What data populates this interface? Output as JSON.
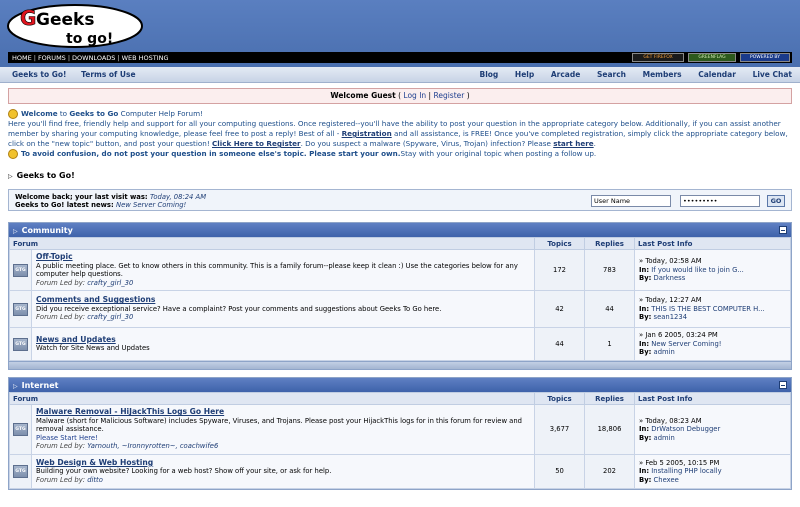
{
  "logo": {
    "text_top": "Geeks",
    "text_bottom": "to go!"
  },
  "topnav": [
    "HOME",
    "FORUMS",
    "DOWNLOADS",
    "WEB HOSTING"
  ],
  "badges": [
    "GET FIREFOX",
    "GREENFLAG",
    "POWERED BY"
  ],
  "subnav": {
    "left": [
      "Geeks to Go!",
      "Terms of Use"
    ],
    "right": [
      "Blog",
      "Help",
      "Arcade",
      "Search",
      "Members",
      "Calendar",
      "Live Chat"
    ]
  },
  "guest": {
    "welcome": "Welcome Guest",
    "open": "( ",
    "login": "Log In",
    "sep": " | ",
    "register": "Register",
    "close": " )"
  },
  "intro": {
    "welcome_pre": "Welcome",
    "welcome_mid": " to ",
    "site_name": "Geeks to Go",
    "welcome_post": " Computer Help Forum!",
    "p1": "Here you'll find free, friendly help and support for all your computing questions. Once registered--you'll have the ability to post your question in the appropriate category below. Additionally, if you can assist another member by sharing your computing knowledge, please feel free to post a reply! Best of all -",
    "registration": "Registration",
    "p2": " and all assistance, is FREE! Once you've completed registration, simply click the appropriate category below, click on the \"new topic\" button, and post your question!",
    "click_here": "Click Here to Register",
    "p3": ". Do you suspect a malware (Spyware, Virus, Trojan) infection? Please",
    "start_here": "start here",
    "p4": ".",
    "warn": "To avoid confusion, do not post your question in someone else's topic. Please start your own.",
    "warn2": " Stay with your original topic when posting a follow up."
  },
  "board_title": "Geeks to Go!",
  "login": {
    "last_visit_label": "Welcome back; your last visit was: ",
    "last_visit_value": "Today, 08:24 AM",
    "news_label": "Geeks to Go! latest news: ",
    "news_value": "New Server Coming!",
    "username_placeholder": "User Name",
    "password_value": "•••••••••",
    "go": "GO"
  },
  "columns": {
    "forum": "Forum",
    "topics": "Topics",
    "replies": "Replies",
    "last": "Last Post Info"
  },
  "icon_label": "GTG",
  "lp": {
    "in": "In:",
    "by": "By:"
  },
  "community": {
    "title": "Community",
    "forums": [
      {
        "name": "Off-Topic",
        "desc": "A public meeting place. Get to know others in this community. This is a family forum--please keep it clean :) Use the categories below for any computer help questions.",
        "led_label": "Forum Led by: ",
        "led": "crafty_girl_30",
        "topics": "172",
        "replies": "783",
        "time": "» Today, 02:58 AM",
        "topic": "If you would like to join G...",
        "by": "Darkness"
      },
      {
        "name": "Comments and Suggestions",
        "desc": "Did you receive exceptional service? Have a complaint? Post your comments and suggestions about Geeks To Go here.",
        "led_label": "Forum Led by: ",
        "led": "crafty_girl_30",
        "topics": "42",
        "replies": "44",
        "time": "» Today, 12:27 AM",
        "topic": "THIS IS THE BEST COMPUTER H...",
        "by": "sean1234"
      },
      {
        "name": "News and Updates",
        "desc": "Watch for Site News and Updates",
        "led_label": "",
        "led": "",
        "topics": "44",
        "replies": "1",
        "time": "» Jan 6 2005, 03:24 PM",
        "topic": "New Server Coming!",
        "by": "admin"
      }
    ]
  },
  "internet": {
    "title": "Internet",
    "forums": [
      {
        "name": "Malware Removal - HiJackThis Logs Go Here",
        "desc": "Malware (short for Malicious Software) includes Spyware, Viruses, and Trojans. Please post your HijackThis logs for in this forum for review and removal assistance.",
        "extra": "Please Start Here!",
        "led_label": "Forum Led by: ",
        "led": "Yarnouth, ~Ironnyrotten~, coachwife6",
        "topics": "3,677",
        "replies": "18,806",
        "time": "» Today, 08:23 AM",
        "topic": "DrWatson Debugger",
        "by": "admin"
      },
      {
        "name": "Web Design & Web Hosting",
        "desc": "Building your own website? Looking for a web host? Show off your site, or ask for help.",
        "extra": "",
        "led_label": "Forum Led by: ",
        "led": "ditto",
        "topics": "50",
        "replies": "202",
        "time": "» Feb 5 2005, 10:15 PM",
        "topic": "Installing PHP locally",
        "by": "Chexee"
      }
    ]
  }
}
